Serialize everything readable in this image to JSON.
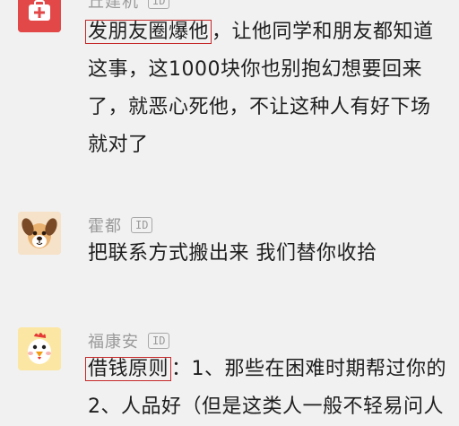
{
  "comments": [
    {
      "username": "丘建机",
      "id_badge": "ID",
      "highlight": "发朋友圈爆他",
      "lines": [
        "，让他同学和朋友都知道",
        "这事，这1000块你也别抱幻想要回来",
        "了，就恶心死他，不让这种人有好下场",
        "就对了"
      ],
      "avatar_icon": "medical-kit-icon"
    },
    {
      "username": "霍都",
      "id_badge": "ID",
      "lines": [
        "把联系方式搬出来 我们替你收拾"
      ],
      "avatar_icon": "dog-icon"
    },
    {
      "username": "福康安",
      "id_badge": "ID",
      "highlight": "借钱原则",
      "lines": [
        "：1、那些在困难时期帮过你的",
        "2、人品好（但是这类人一般不轻易问人"
      ],
      "avatar_icon": "chicken-icon"
    }
  ],
  "colors": {
    "background": "#f1f1f1",
    "highlight_border": "#c62828",
    "username": "#9a9a9a"
  }
}
